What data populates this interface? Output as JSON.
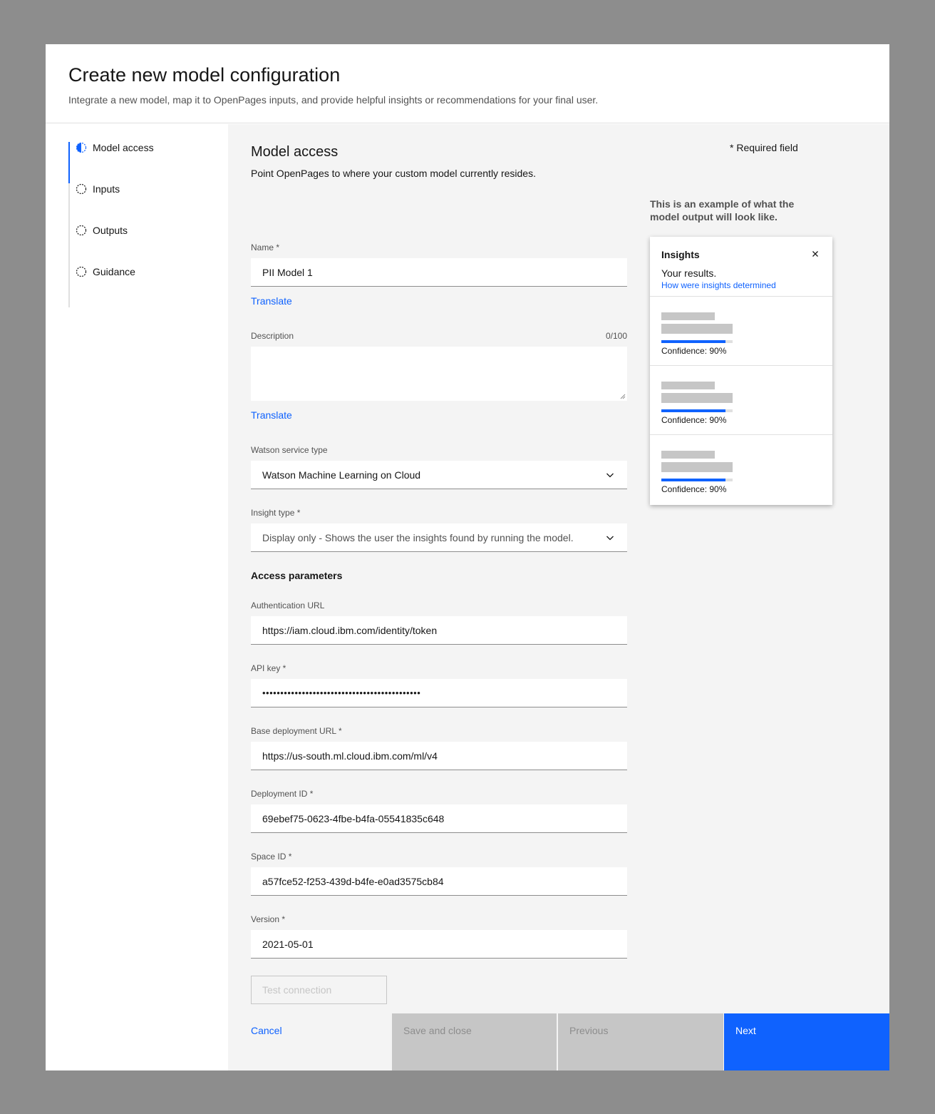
{
  "modal": {
    "title": "Create new model configuration",
    "subtitle": "Integrate a new model, map it to OpenPages inputs, and provide helpful insights or recommendations for your final user."
  },
  "steps": [
    {
      "label": "Model access",
      "icon": "half-circle-icon",
      "state": "current"
    },
    {
      "label": "Inputs",
      "icon": "dashed-circle-icon",
      "state": "incomplete"
    },
    {
      "label": "Outputs",
      "icon": "dashed-circle-icon",
      "state": "incomplete"
    },
    {
      "label": "Guidance",
      "icon": "dashed-circle-icon",
      "state": "incomplete"
    }
  ],
  "section": {
    "title": "Model access",
    "description": "Point OpenPages to where your custom model currently resides.",
    "required_note": "* Required field"
  },
  "form": {
    "name": {
      "label": "Name *",
      "value": "PII Model 1",
      "translate": "Translate"
    },
    "description": {
      "label": "Description",
      "counter": "0/100",
      "value": "",
      "translate": "Translate"
    },
    "service_type": {
      "label": "Watson service type",
      "value": "Watson Machine Learning on Cloud"
    },
    "insight_type": {
      "label": "Insight type *",
      "value": "Display only - Shows the user the insights found by running the model."
    },
    "access_heading": "Access parameters",
    "auth_url": {
      "label": "Authentication URL",
      "value": "https://iam.cloud.ibm.com/identity/token"
    },
    "api_key": {
      "label": "API key *",
      "value": "••••••••••••••••••••••••••••••••••••••••••••"
    },
    "base_url": {
      "label": "Base deployment URL *",
      "value": "https://us-south.ml.cloud.ibm.com/ml/v4"
    },
    "deployment_id": {
      "label": "Deployment ID *",
      "value": "69ebef75-0623-4fbe-b4fa-05541835c648"
    },
    "space_id": {
      "label": "Space ID *",
      "value": "a57fce52-f253-439d-b4fe-e0ad3575cb84"
    },
    "version": {
      "label": "Version *",
      "value": "2021-05-01"
    },
    "test_button": "Test connection"
  },
  "preview": {
    "note": "This is an example of what the model output will look like.",
    "panel_title": "Insights",
    "results_text": "Your results.",
    "link": "How were insights determined",
    "cards": [
      {
        "confidence_label": "Confidence: 90%",
        "confidence": 0.9
      },
      {
        "confidence_label": "Confidence: 90%",
        "confidence": 0.9
      },
      {
        "confidence_label": "Confidence: 90%",
        "confidence": 0.9
      }
    ]
  },
  "footer": {
    "cancel": "Cancel",
    "save_close": "Save and close",
    "previous": "Previous",
    "next": "Next"
  },
  "colors": {
    "accent": "#0f62fe",
    "disabled": "#c6c6c6",
    "backdrop": "#8d8d8d",
    "panel_bg": "#f4f4f4"
  }
}
